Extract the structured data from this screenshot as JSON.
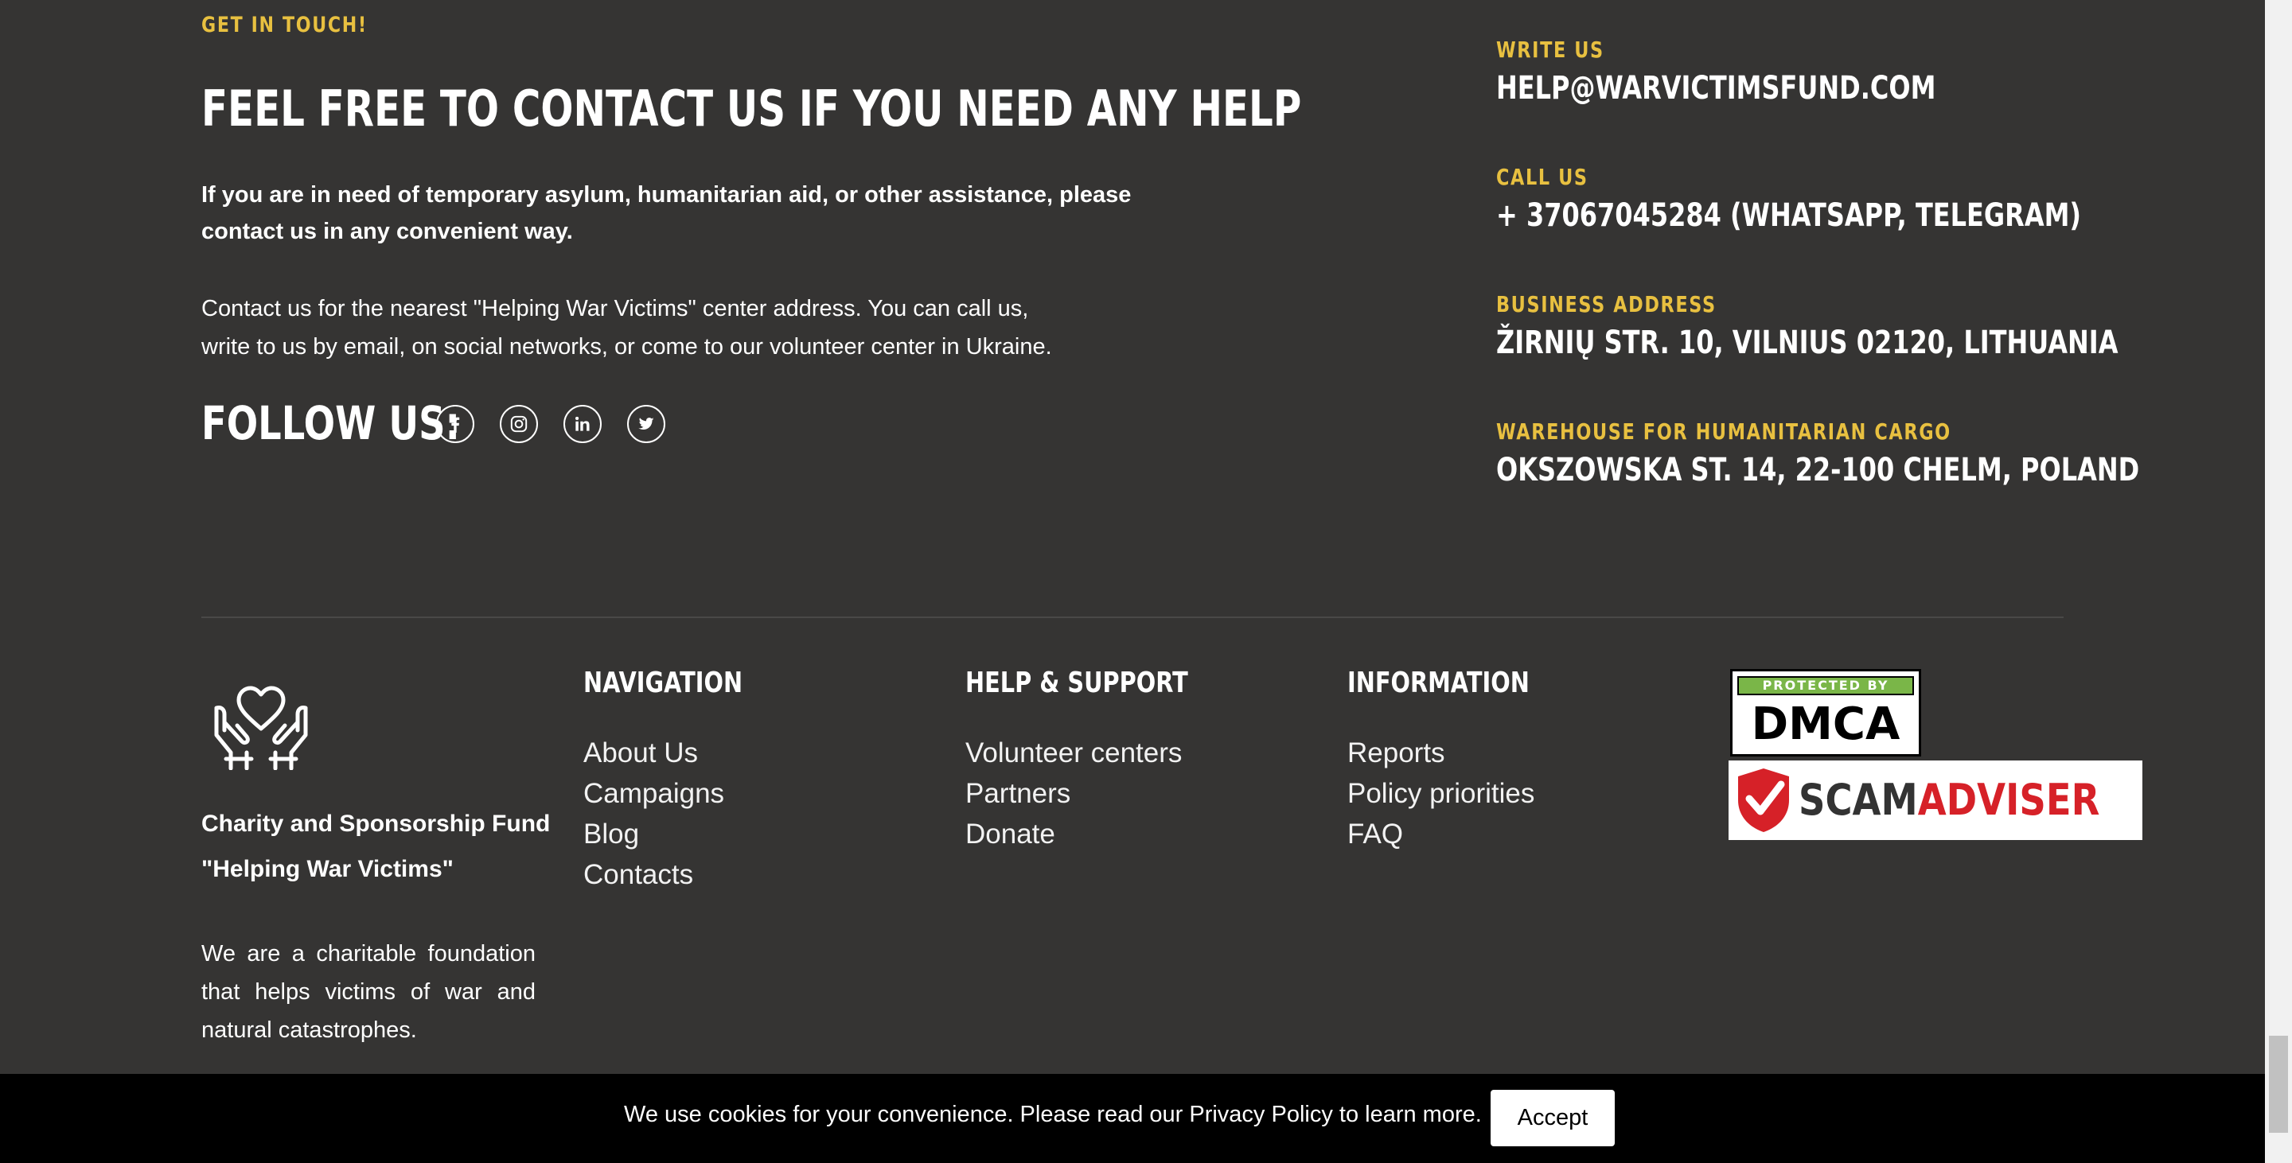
{
  "contact": {
    "kicker": "GET IN TOUCH!",
    "heading": "FEEL FREE TO CONTACT US IF YOU NEED ANY HELP",
    "intro_line1": "If you are in need of temporary asylum, humanitarian aid, or other assistance, please",
    "intro_line2": "contact us in any convenient way.",
    "body_line1": "Contact us for the nearest \"Helping War Victims\" center address. You can call us,",
    "body_line2": "write to us by email, on social networks, or come to our volunteer center in Ukraine.",
    "follow_label": "FOLLOW US:",
    "social_icons": [
      "facebook-icon",
      "instagram-icon",
      "linkedin-icon",
      "twitter-icon"
    ]
  },
  "details": {
    "write_label": "WRITE US",
    "write_value": "HELP@WARVICTIMSFUND.COM",
    "call_label": "CALL US",
    "call_value": "+ 37067045284 (WHATSAPP, TELEGRAM)",
    "business_label": "BUSINESS ADDRESS",
    "business_value": "ŽIRNIŲ STR. 10, VILNIUS 02120, LITHUANIA",
    "warehouse_label": "WAREHOUSE FOR HUMANITARIAN CARGO",
    "warehouse_value": "OKSZOWSKA ST. 14, 22-100 CHELM, POLAND"
  },
  "footer": {
    "org_name_line1": "Charity and Sponsorship Fund",
    "org_name_line2": "\"Helping War Victims\"",
    "about_line1": "We are a charitable foundation",
    "about_line2": "that helps victims of war and",
    "about_line3": "natural catastrophes.",
    "navigation": {
      "title": "NAVIGATION",
      "links": [
        "About Us",
        "Campaigns",
        "Blog",
        "Contacts"
      ]
    },
    "help": {
      "title": "HELP & SUPPORT",
      "links": [
        "Volunteer centers",
        "Partners",
        "Donate"
      ]
    },
    "information": {
      "title": "INFORMATION",
      "links": [
        "Reports",
        "Policy priorities",
        "FAQ"
      ]
    },
    "badges": {
      "dmca_top": "PROTECTED BY",
      "dmca_main": "DMCA",
      "scam_part1": "SCAM",
      "scam_part2": "ADVISER"
    }
  },
  "cookie": {
    "message": "We use cookies for your convenience. Please read our Privacy Policy to learn more.",
    "accept_label": "Accept"
  },
  "colors": {
    "background": "#353433",
    "accent": "#e8c040",
    "cookie_bar": "#000000"
  }
}
